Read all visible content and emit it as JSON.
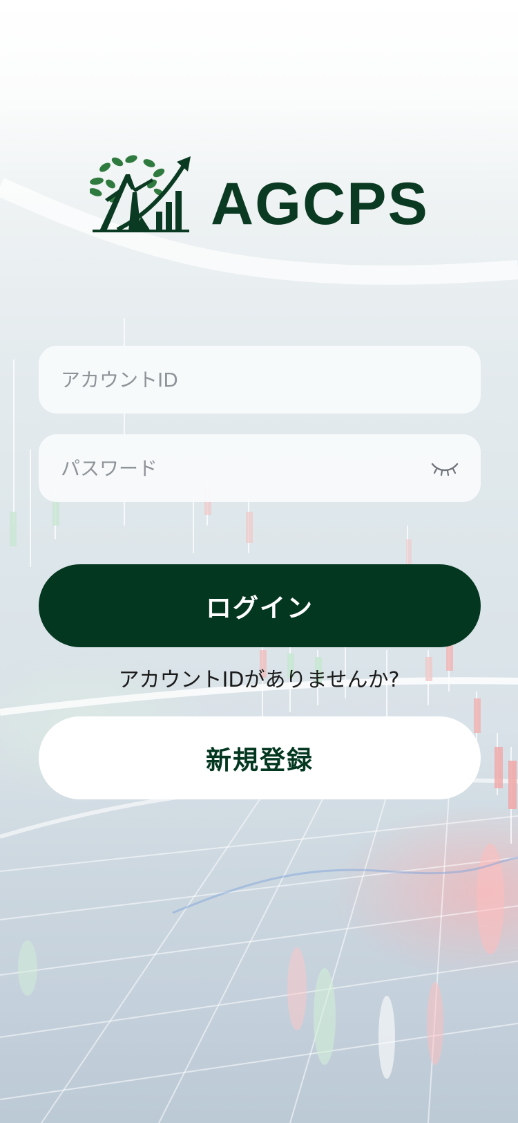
{
  "app": {
    "brand_name": "AGCPS",
    "logo_icon": "tree-growth-arrow-icon",
    "brand_color": "#0b3a22"
  },
  "login_form": {
    "account_id": {
      "value": "",
      "placeholder": "アカウントID"
    },
    "password": {
      "value": "",
      "placeholder": "パスワード",
      "toggle_icon": "eye-closed-icon"
    },
    "login_label": "ログイン",
    "no_account_prompt": "アカウントIDがありませんか?",
    "register_label": "新規登録"
  },
  "colors": {
    "primary_button": "#033720",
    "secondary_button": "#ffffff"
  }
}
